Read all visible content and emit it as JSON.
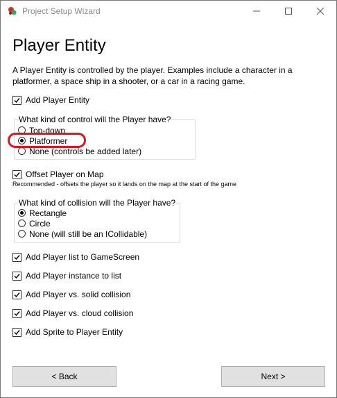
{
  "window": {
    "title": "Project Setup Wizard",
    "minimize_icon": "minimize-icon",
    "maximize_icon": "maximize-icon",
    "close_icon": "close-icon"
  },
  "page": {
    "heading": "Player Entity",
    "description": "A Player Entity is controlled by the player. Examples include a character in a platformer, a space ship in a shooter, or a car in a racing game."
  },
  "add_player_entity": {
    "label": "Add Player Entity",
    "checked": true
  },
  "control_group": {
    "label": "What kind of control will the Player have?",
    "options": [
      {
        "label": "Top-down",
        "selected": false
      },
      {
        "label": "Platformer",
        "selected": true
      },
      {
        "label": "None (controls be added later)",
        "selected": false
      }
    ]
  },
  "offset_player": {
    "label": "Offset Player on Map",
    "checked": true,
    "note": "Recommended - offsets the player so it lands on the map at the start of the game"
  },
  "collision_group": {
    "label": "What kind of collision will the Player have?",
    "options": [
      {
        "label": "Rectangle",
        "selected": true
      },
      {
        "label": "Circle",
        "selected": false
      },
      {
        "label": "None (will still be an ICollidable)",
        "selected": false
      }
    ]
  },
  "options": [
    {
      "label": "Add Player list to GameScreen",
      "checked": true
    },
    {
      "label": "Add Player instance to list",
      "checked": true
    },
    {
      "label": "Add Player vs. solid collision",
      "checked": true
    },
    {
      "label": "Add Player vs. cloud collision",
      "checked": true
    },
    {
      "label": "Add Sprite to Player Entity",
      "checked": true
    }
  ],
  "buttons": {
    "back": "< Back",
    "next": "Next >"
  },
  "colors": {
    "highlight": "#e0141e",
    "button_bg": "#e1e1e1"
  }
}
